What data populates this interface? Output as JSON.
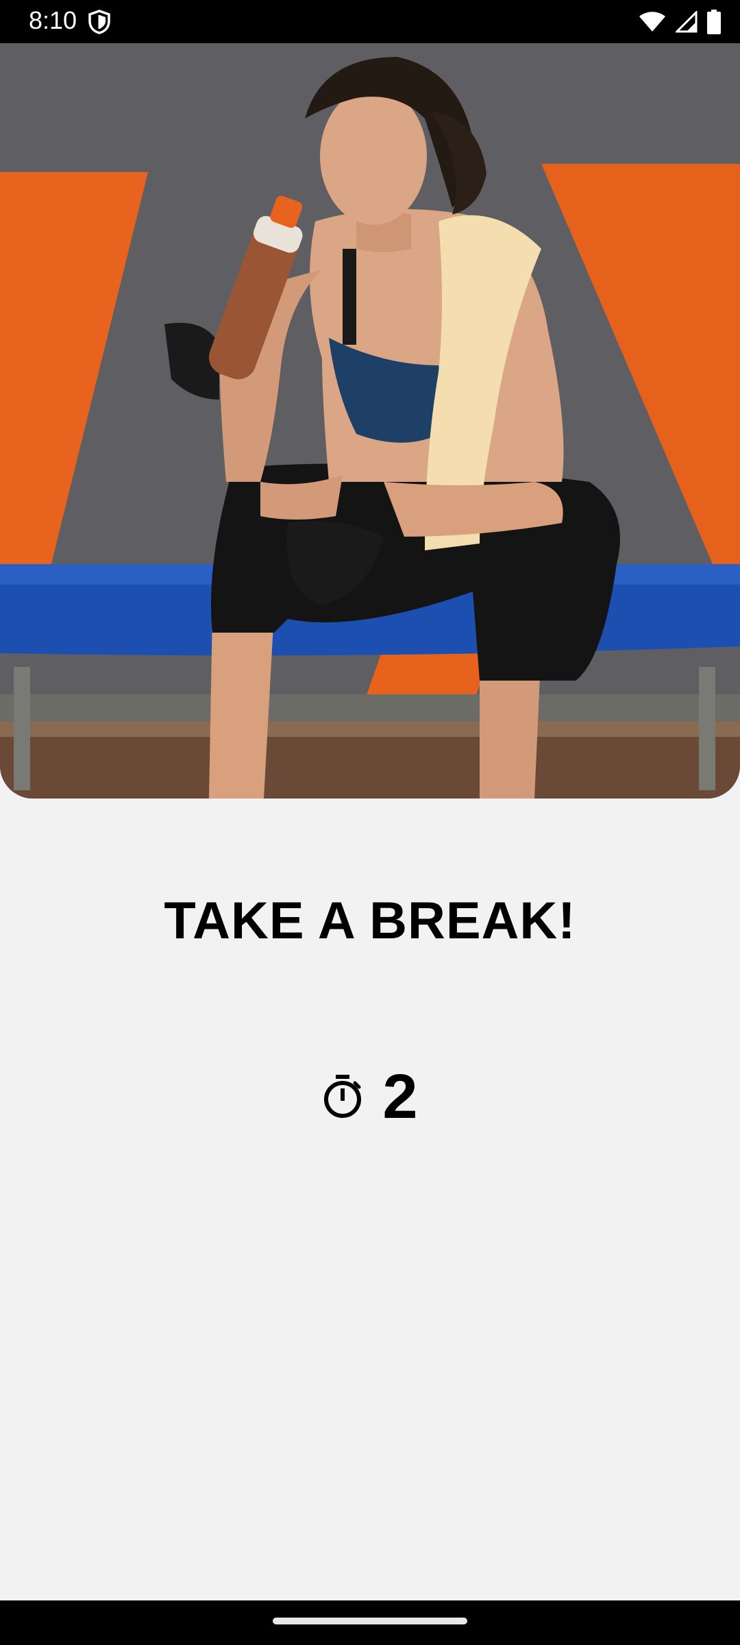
{
  "status_bar": {
    "time": "8:10",
    "icons": [
      "shield-icon",
      "wifi-icon",
      "signal-icon",
      "battery-icon"
    ]
  },
  "hero": {
    "image": "woman-drinking-from-shaker-bottle-on-gym-bench",
    "colors": {
      "wall": "#5f5f63",
      "stripe": "#e8641e",
      "bench": "#1d4fb0"
    }
  },
  "break_screen": {
    "title": "TAKE A BREAK!",
    "timer_icon": "stopwatch-icon",
    "timer_value": "2"
  },
  "colors": {
    "background": "#f2f2f2",
    "text": "#000000"
  }
}
